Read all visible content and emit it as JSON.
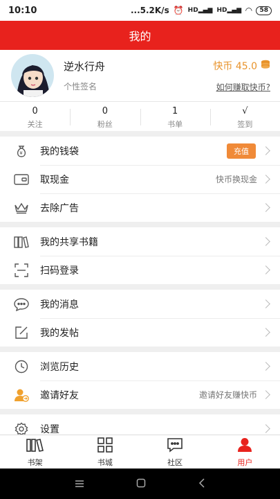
{
  "status": {
    "time": "10:10",
    "speed": "...5.2K/s",
    "signal1": "HD",
    "signal2": "HD",
    "battery": "58"
  },
  "header": {
    "title": "我的"
  },
  "profile": {
    "username": "逆水行舟",
    "signature": "个性签名",
    "coins": "快币 45.0",
    "earn_link": "如何赚取快币?"
  },
  "stats": [
    {
      "value": "0",
      "label": "关注"
    },
    {
      "value": "0",
      "label": "粉丝"
    },
    {
      "value": "1",
      "label": "书单"
    },
    {
      "value": "√",
      "label": "签到"
    }
  ],
  "menu": {
    "wallet": {
      "label": "我的钱袋",
      "badge": "充值"
    },
    "withdraw": {
      "label": "取现金",
      "hint": "快币换现金"
    },
    "noads": {
      "label": "去除广告"
    },
    "shared": {
      "label": "我的共享书籍"
    },
    "scan": {
      "label": "扫码登录"
    },
    "messages": {
      "label": "我的消息"
    },
    "posts": {
      "label": "我的发帖"
    },
    "history": {
      "label": "浏览历史"
    },
    "invite": {
      "label": "邀请好友",
      "hint": "邀请好友赚快币"
    },
    "settings": {
      "label": "设置"
    }
  },
  "tabs": [
    {
      "label": "书架",
      "icon": "bookshelf-icon"
    },
    {
      "label": "书城",
      "icon": "bookstore-grid-icon"
    },
    {
      "label": "社区",
      "icon": "community-chat-icon"
    },
    {
      "label": "用户",
      "icon": "user-icon"
    }
  ],
  "colors": {
    "brand": "#e8221d",
    "coin": "#e8932b",
    "badge": "#f08a38"
  }
}
